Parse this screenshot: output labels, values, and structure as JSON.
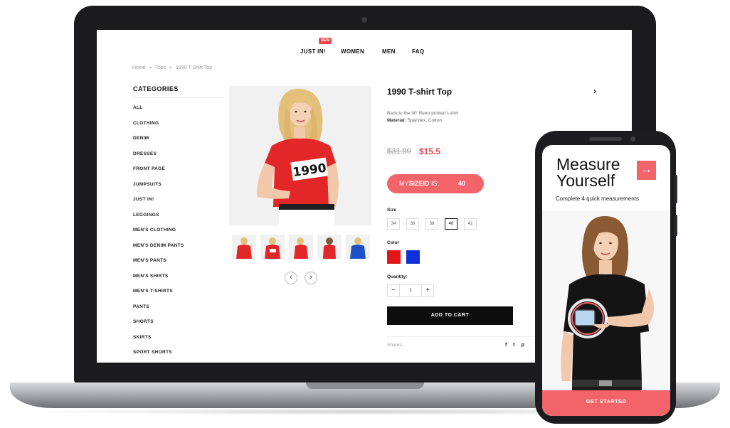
{
  "nav": {
    "badge": "NEW",
    "items": [
      "JUST IN!",
      "WOMEN",
      "MEN",
      "FAQ"
    ]
  },
  "breadcrumb": [
    "Home",
    "»",
    "Tops",
    "»",
    "1990 T-Shirt Top"
  ],
  "sidebar": {
    "title": "CATEGORIES",
    "items": [
      "ALL",
      "CLOTHING",
      "DENIM",
      "DRESSES",
      "FRONT PAGE",
      "JUMPSUITS",
      "JUST IN!",
      "LEGGINGS",
      "MEN'S CLOTHING",
      "MEN'S DENIM PANTS",
      "MEN'S PANTS",
      "MEN'S SHIRTS",
      "MEN'S T-SHIRTS",
      "PANTS",
      "SHORTS",
      "SKIRTS",
      "SPORT SHORTS"
    ]
  },
  "gallery": {
    "shirt_text": "1990",
    "prev_label": "‹",
    "next_label": "›"
  },
  "product": {
    "title": "1990 T-shirt Top",
    "next_label": "›",
    "desc_line1": "Back to the 90' Retro printed t-shirt",
    "material_label": "Material:",
    "material_value": "Spandex, Cotton",
    "price_old": "$31.99",
    "price_new": "$15.5",
    "mysize_prefix": "MY",
    "mysize_brand": "SIZEID",
    "mysize_suffix": " IS:",
    "mysize_value": "40",
    "size_label": "Size",
    "sizes": [
      "34",
      "36",
      "38",
      "40",
      "42"
    ],
    "selected_size": "40",
    "color_label": "Color",
    "colors": [
      "#e01818",
      "#1230d8"
    ],
    "quantity_label": "Quantity:",
    "qty_minus": "−",
    "qty_plus": "+",
    "qty_value": "1",
    "add_to_cart": "ADD TO CART",
    "shares_label": "Shares:",
    "share_icons": [
      "f",
      "t",
      "p"
    ]
  },
  "phone": {
    "title_line1": "Measure",
    "title_line2": "Yourself",
    "arrow": "→",
    "subtitle": "Complete 4 quick measurements",
    "cta": "GET STARTED"
  }
}
